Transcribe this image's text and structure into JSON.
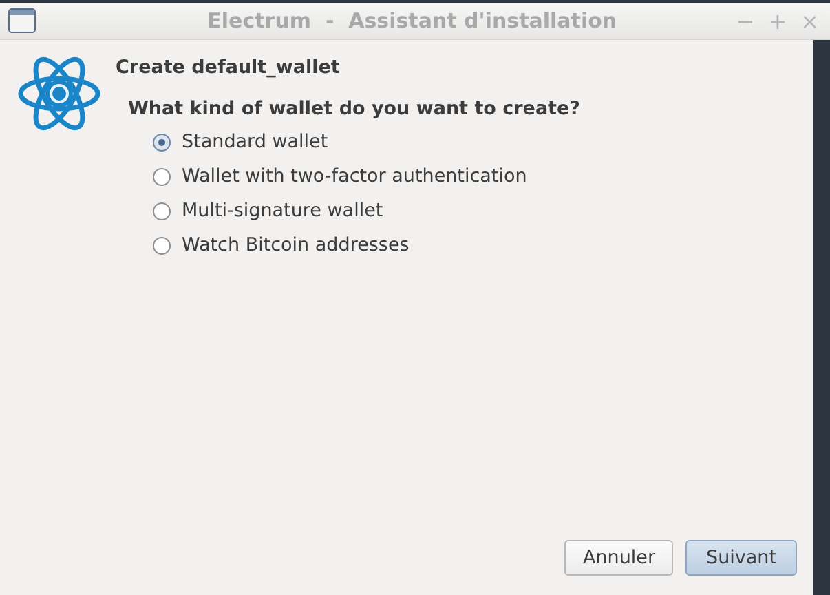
{
  "window": {
    "title": "Electrum  -  Assistant d'installation",
    "controls": [
      "−",
      "+",
      "×"
    ]
  },
  "heading": "Create default_wallet",
  "question": "What kind of wallet do you want to create?",
  "options": [
    {
      "label": "Standard wallet",
      "selected": true
    },
    {
      "label": "Wallet with two-factor authentication",
      "selected": false
    },
    {
      "label": "Multi-signature wallet",
      "selected": false
    },
    {
      "label": "Watch Bitcoin addresses",
      "selected": false
    }
  ],
  "buttons": [
    {
      "label": "Annuler",
      "kind": "normal"
    },
    {
      "label": "Suivant",
      "kind": "default"
    }
  ]
}
